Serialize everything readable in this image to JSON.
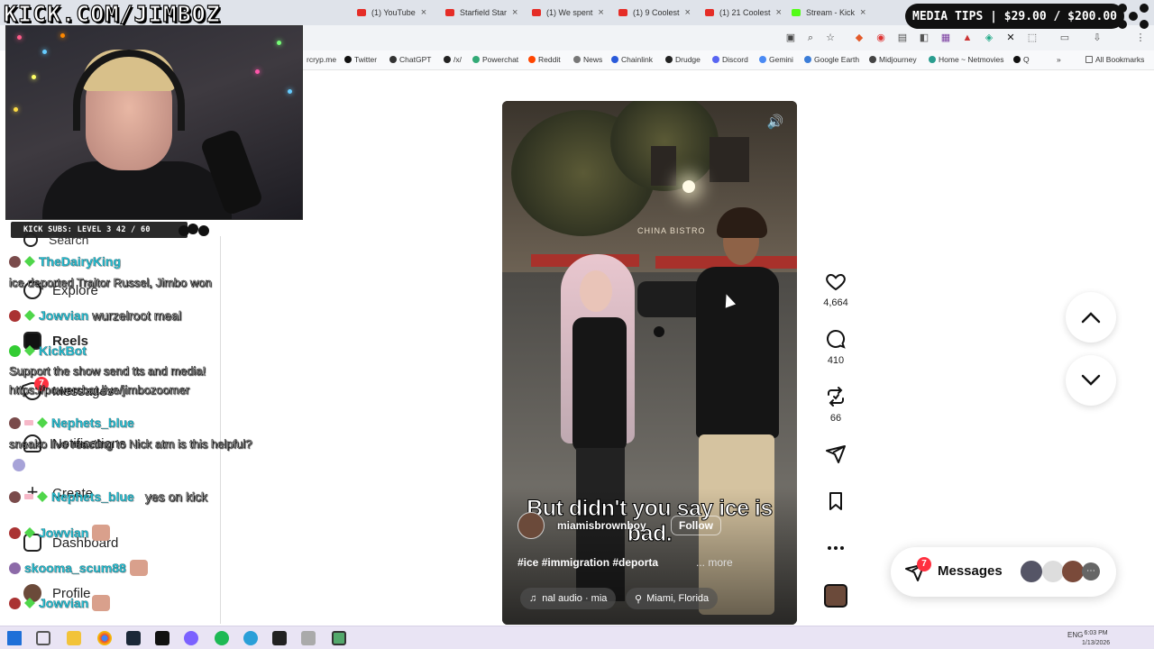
{
  "overlay": {
    "kick_url": "KICK.COM/JIMBOZ",
    "media_tips": "MEDIA TIPS | $29.00 / $200.00",
    "kick_subs": "KICK SUBS: LEVEL 3 42 / 60"
  },
  "browser": {
    "tabs": [
      {
        "label": "(1) YouTube"
      },
      {
        "label": "Starfield Star"
      },
      {
        "label": "(1) We spent"
      },
      {
        "label": "(1) 9 Coolest"
      },
      {
        "label": "(1) 21 Coolest"
      },
      {
        "label": "Stream - Kick"
      }
    ],
    "bookmarks": [
      "rcryp.me",
      "Twitter",
      "ChatGPT",
      "/x/",
      "Powerchat",
      "Reddit",
      "News",
      "Chainlink",
      "Drudge",
      "Discord",
      "Gemini",
      "Google Earth",
      "Midjourney",
      "Home ~ Netmovies",
      "Q"
    ],
    "all_bookmarks": "All Bookmarks"
  },
  "ig_nav": {
    "items": [
      "Search",
      "Explore",
      "Reels",
      "Messages",
      "Notifications",
      "Create",
      "Dashboard",
      "Profile"
    ],
    "messages_badge": "7"
  },
  "chat": {
    "lines": [
      {
        "user": "TheDairyKing",
        "msg": ""
      },
      {
        "user": "",
        "msg": "ice deported Traitor Russel, Jimbo won"
      },
      {
        "user": "Jowvian",
        "msg": "wurzelroot meal"
      },
      {
        "user": "KickBot",
        "msg": ""
      },
      {
        "user": "",
        "msg": "Support the show send tts and media!"
      },
      {
        "user": "",
        "msg": "https://powerchat.live/jimbozoomer"
      },
      {
        "user": "Nephets_blue",
        "msg": ""
      },
      {
        "user": "",
        "msg": "sneako live reacting to Nick atm is this helpful?"
      },
      {
        "user": "Nephets_blue",
        "msg": "yes on kick"
      },
      {
        "user": "Jowvian",
        "msg": ""
      },
      {
        "user": "skooma_scum88",
        "msg": ""
      },
      {
        "user": "Jowvian",
        "msg": ""
      }
    ]
  },
  "video": {
    "caption": "But didn't you say ice is bad.",
    "author": "miamisbrownboy",
    "follow_label": "Follow",
    "hashtags": "#ice #immigration #deporta",
    "more_label": "... more",
    "audio": "nal audio · mia",
    "location": "Miami, Florida",
    "storefront": "CHINA BISTRO"
  },
  "actions": {
    "likes": "4,664",
    "comments": "410",
    "reposts": "66"
  },
  "messages": {
    "label": "Messages",
    "count": "7"
  },
  "taskbar": {
    "lang": "ENG",
    "time": "6:03 PM",
    "date": "1/13/2026"
  },
  "colors": {
    "chat_username": "#27c3d8",
    "notification_red": "#ff3040",
    "kick_green": "#53fc18"
  }
}
